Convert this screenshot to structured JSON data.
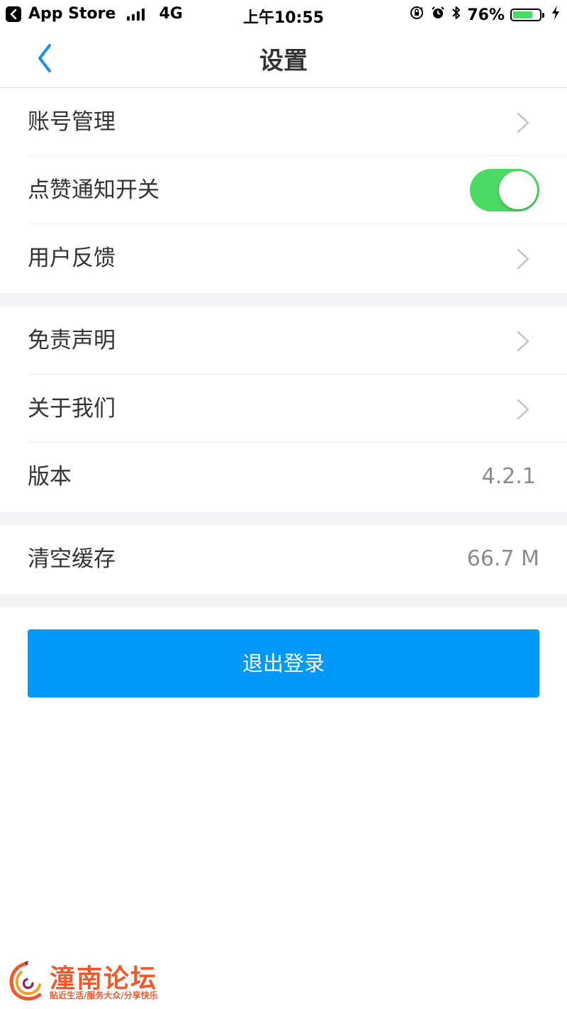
{
  "status_bar": {
    "back_app": "App Store",
    "network": "4G",
    "time": "上午10:55",
    "battery": "76%",
    "battery_level": 0.76
  },
  "nav": {
    "title": "设置"
  },
  "section1": [
    {
      "label": "账号管理"
    },
    {
      "label": "点赞通知开关",
      "toggle_on": true
    },
    {
      "label": "用户反馈"
    }
  ],
  "section2": [
    {
      "label": "免责声明"
    },
    {
      "label": "关于我们"
    },
    {
      "label": "版本",
      "value": "4.2.1"
    }
  ],
  "section3": [
    {
      "label": "清空缓存",
      "value": "66.7 M"
    }
  ],
  "logout_label": "退出登录",
  "watermark": {
    "title": "潼南论坛",
    "subtitle": "贴近生活/服务大众/分享快乐"
  },
  "colors": {
    "accent": "#0099f9",
    "toggle_on": "#4cd964",
    "nav_back": "#1a8ff0"
  }
}
